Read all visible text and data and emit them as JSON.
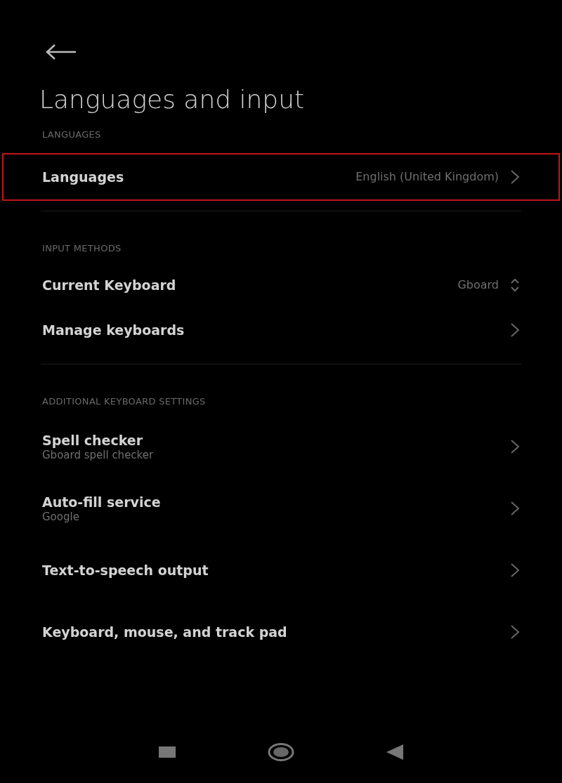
{
  "title": "Languages and input",
  "sections": [
    {
      "header": "LANGUAGES",
      "items": [
        {
          "kind": "link",
          "label": "Languages",
          "value": "English (United Kingdom)",
          "highlighted": true
        }
      ]
    },
    {
      "header": "INPUT METHODS",
      "items": [
        {
          "kind": "spinner",
          "label": "Current Keyboard",
          "value": "Gboard",
          "highlighted": false
        },
        {
          "kind": "link",
          "label": "Manage keyboards",
          "highlighted": false
        }
      ]
    },
    {
      "header": "ADDITIONAL KEYBOARD SETTINGS",
      "items": [
        {
          "kind": "link",
          "label": "Spell checker",
          "summary": "Gboard spell checker",
          "highlighted": false
        },
        {
          "kind": "link",
          "label": "Auto-fill service",
          "summary": "Google",
          "highlighted": false
        },
        {
          "kind": "link",
          "label": "Text-to-speech output",
          "highlighted": false
        },
        {
          "kind": "link",
          "label": "Keyboard, mouse, and track pad",
          "highlighted": false
        }
      ]
    }
  ]
}
